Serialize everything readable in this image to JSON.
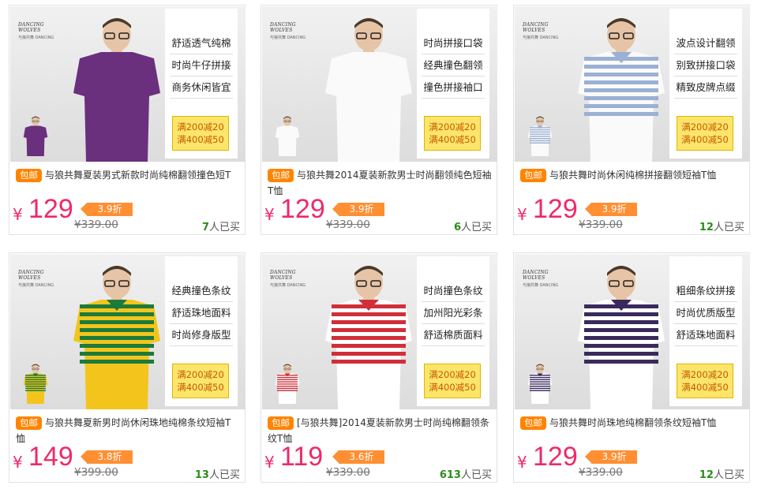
{
  "brand": {
    "logo_text": "DANCING WOLVES",
    "logo_sub": "与狼共舞 DANCING"
  },
  "currency": "¥",
  "bought_suffix": "人已买",
  "baoyou_label": "包邮",
  "promo": {
    "line1": "满200减20",
    "line2": "满400减50"
  },
  "colors": {
    "price": "#ee2a68",
    "discount_tag": "#ff8f32",
    "baoyou": "#ff8400",
    "sold_count": "#2b8c1a",
    "promo_bg": "#fbe56a"
  },
  "products": [
    {
      "features": [
        "舒适透气纯棉",
        "时尚牛仔拼接",
        "商务休闲皆宜"
      ],
      "title": "与狼共舞夏装男式新款时尚纯棉翻领撞色短T",
      "price": "129",
      "discount": "3.9折",
      "original": "339.00",
      "sold": "7",
      "shirt": "purple"
    },
    {
      "features": [
        "时尚拼接口袋",
        "经典撞色翻领",
        "撞色拼接袖口"
      ],
      "title": "与狼共舞2014夏装新款男士时尚翻领纯色短袖T恤",
      "price": "129",
      "discount": "3.9折",
      "original": "339.00",
      "sold": "6",
      "shirt": "white"
    },
    {
      "features": [
        "波点设计翻领",
        "别致拼接口袋",
        "精致皮牌点缀"
      ],
      "title": "与狼共舞时尚休闲纯棉拼接翻领短袖T恤",
      "price": "129",
      "discount": "3.9折",
      "original": "339.00",
      "sold": "12",
      "shirt": "whiteblue"
    },
    {
      "features": [
        "经典撞色条纹",
        "舒适珠地面料",
        "时尚修身版型"
      ],
      "title": "与狼共舞夏新男时尚休闲珠地纯棉条纹短袖T恤",
      "price": "149",
      "discount": "3.8折",
      "original": "399.00",
      "sold": "13",
      "shirt": "yellowstripe"
    },
    {
      "features": [
        "时尚撞色条纹",
        "加州阳光彩条",
        "舒适棉质面料"
      ],
      "title": "[与狼共舞]2014夏装新款男士时尚纯棉翻领条纹T恤",
      "price": "119",
      "discount": "3.6折",
      "original": "339.00",
      "sold": "613",
      "shirt": "redstripe"
    },
    {
      "features": [
        "粗细条纹拼接",
        "时尚优质版型",
        "舒适珠地面料"
      ],
      "title": "与狼共舞时尚珠地纯棉翻领条纹短袖T恤",
      "price": "129",
      "discount": "3.9折",
      "original": "339.00",
      "sold": "12",
      "shirt": "navystripe"
    }
  ]
}
